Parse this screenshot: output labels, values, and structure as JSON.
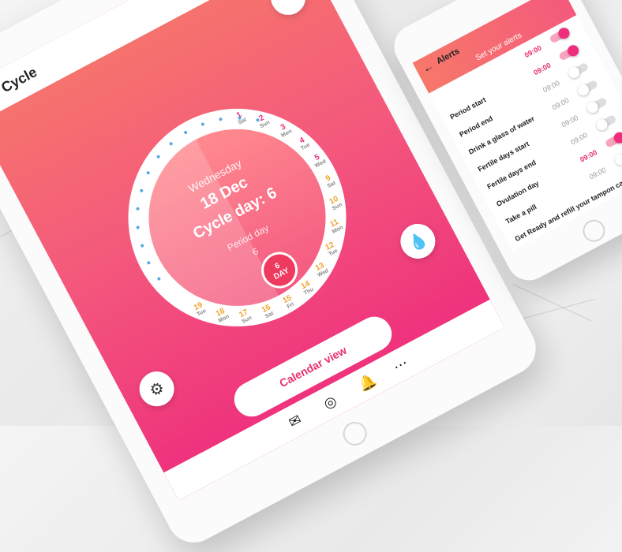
{
  "tablet": {
    "title": "Cycle",
    "center": {
      "day_name": "Wednesday",
      "date": "18 Dec",
      "cycle_day": "Cycle day: 6",
      "period_label": "Period day",
      "period_value": "6"
    },
    "today_badge": {
      "num": "6",
      "label": "DAY"
    },
    "calendar_button": "Calendar view",
    "days": [
      {
        "num": "1",
        "wd": "Sat"
      },
      {
        "num": "2",
        "wd": "Sun"
      },
      {
        "num": "3",
        "wd": "Mon"
      },
      {
        "num": "4",
        "wd": "Tue"
      },
      {
        "num": "5",
        "wd": "Wed"
      },
      {
        "num": "9",
        "wd": "Sat"
      },
      {
        "num": "10",
        "wd": "Sun"
      },
      {
        "num": "11",
        "wd": "Mon"
      },
      {
        "num": "12",
        "wd": "Tue"
      },
      {
        "num": "13",
        "wd": "Wed"
      },
      {
        "num": "14",
        "wd": "Thu"
      },
      {
        "num": "15",
        "wd": "Fri"
      },
      {
        "num": "16",
        "wd": "Sat"
      },
      {
        "num": "17",
        "wd": "Sun"
      },
      {
        "num": "18",
        "wd": "Mon"
      },
      {
        "num": "19",
        "wd": "Tue"
      }
    ],
    "colors": {
      "accent": "#ee2d7d",
      "gradient_top": "#f7786a",
      "fertile": "#f0a330"
    }
  },
  "phone": {
    "title": "Alerts",
    "subtitle": "Set your alerts",
    "rows": [
      {
        "label": "",
        "time": "09:00",
        "on": true
      },
      {
        "label": "Period start",
        "time": "09:00",
        "on": true
      },
      {
        "label": "Period end",
        "time": "09:00",
        "on": false
      },
      {
        "label": "Drink a glass of water",
        "time": "09:00",
        "on": false
      },
      {
        "label": "Fertile days start",
        "time": "09:00",
        "on": false
      },
      {
        "label": "Fertile days end",
        "time": "09:00",
        "on": false
      },
      {
        "label": "Ovulation day",
        "time": "09:00",
        "on": true
      },
      {
        "label": "Take a pill",
        "time": "09:00",
        "on": false
      },
      {
        "label": "Get Ready and refill your tampon case",
        "time": "",
        "on": false
      }
    ]
  }
}
